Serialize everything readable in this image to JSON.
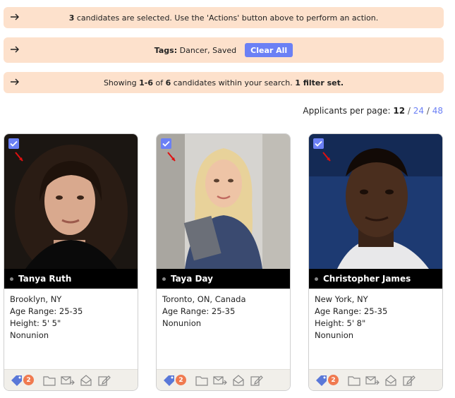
{
  "banners": {
    "selected": {
      "count": "3",
      "text": " candidates are selected. Use the 'Actions' button above to perform an action."
    },
    "tags": {
      "label": "Tags:",
      "values": " Dancer, Saved",
      "clear_label": "Clear All"
    },
    "showing": {
      "prefix": "Showing ",
      "range": "1-6",
      "of": " of ",
      "total": "6",
      "suffix": " candidates within your search. ",
      "filters": "1 filter set."
    }
  },
  "per_page": {
    "label": "Applicants per page: ",
    "current": "12",
    "sep": " / ",
    "opt2": "24",
    "opt3": "48"
  },
  "colors": {
    "accent": "#6b80f5",
    "banner_bg": "#fde1cc",
    "badge": "#f07a50"
  },
  "candidates": [
    {
      "name": "Tanya Ruth",
      "location": "Brooklyn, NY",
      "age": "Age Range: 25-35",
      "height": "Height: 5' 5\"",
      "union": "Nonunion",
      "tags_count": "2"
    },
    {
      "name": "Taya Day",
      "location": "Toronto, ON, Canada",
      "age": "Age Range: 25-35",
      "height": "Nonunion",
      "union": "",
      "tags_count": "2"
    },
    {
      "name": "Christopher James",
      "location": "New York, NY",
      "age": "Age Range: 25-35",
      "height": "Height: 5' 8\"",
      "union": "Nonunion",
      "tags_count": "2"
    }
  ]
}
